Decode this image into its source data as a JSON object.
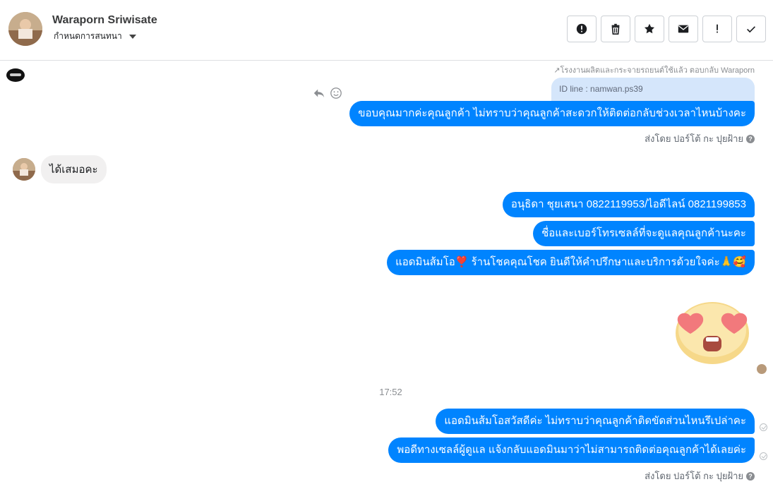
{
  "header": {
    "name": "Waraporn Sriwisate",
    "subtitle": "กำหนดการสนทนา"
  },
  "actions": [
    {
      "icon": "alert-circle-icon"
    },
    {
      "icon": "trash-icon"
    },
    {
      "icon": "star-icon"
    },
    {
      "icon": "envelope-icon"
    },
    {
      "icon": "exclamation-icon"
    },
    {
      "icon": "check-icon"
    }
  ],
  "thread": {
    "top_note": "↗โรงงานผลิตและกระจายรถยนต์ใช้แล้ว ตอบกลับ Waraporn",
    "reply_quote": "ID line : namwan.ps39",
    "msg1": "ขอบคุณมากค่ะคุณลูกค้า ไม่ทราบว่าคุณลูกค้าสะดวกให้ติดต่อกลับช่วงเวลาไหนบ้างคะ",
    "sent_by_1": "ส่งโดย ปอร์โต้ กะ ปุยฝ้าย",
    "incoming": "ได้เสมอคะ",
    "msg2": "อนุธิดา ชุยเสนา      0822119953/ไอดีไลน์ 0821199853",
    "msg3": "ชื่อและเบอร์โทรเซลล์ที่จะดูแลคุณลูกค้านะคะ",
    "msg4": "แอดมินส้มโอ❣️ ร้านโชคคุณโชค ยินดีให้คำปรึกษาและบริการด้วยใจค่ะ🙏🥰",
    "timestamp": "17:52",
    "msg5": "แอดมินส้มโอสวัสดีค่ะ ไม่ทราบว่าคุณลูกค้าติดขัดส่วนไหนรึเปล่าคะ",
    "msg6": "พอดีทางเซลล์ผู้ดูแล แจ้งกลับแอดมินมาว่าไม่สามารถติดต่อคุณลูกค้าได้เลยค่ะ",
    "sent_by_2": "ส่งโดย ปอร์โต้ กะ ปุยฝ้าย"
  },
  "colors": {
    "outgoing": "#0084ff",
    "incoming": "#f1f0f0",
    "reply_card": "#d5e6fb"
  }
}
